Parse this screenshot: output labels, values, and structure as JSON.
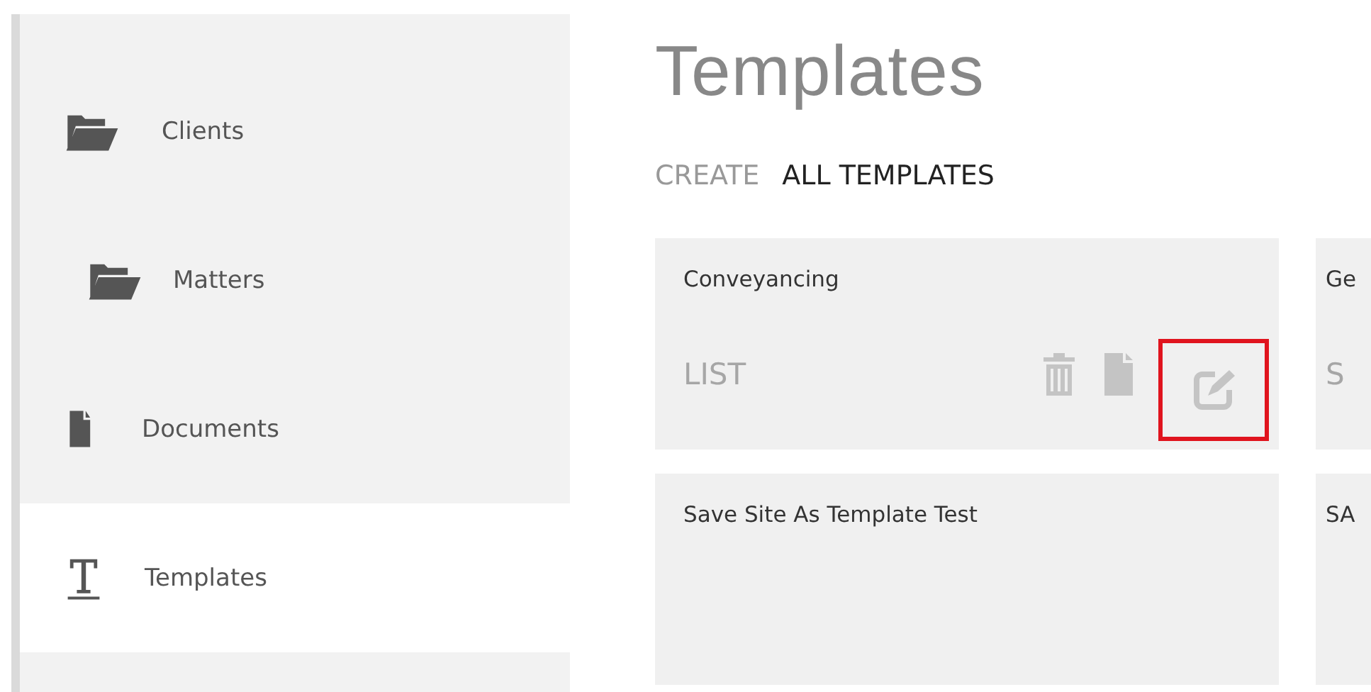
{
  "sidebar": {
    "items": [
      {
        "label": "Clients",
        "kind": "folder",
        "indented": false,
        "selected": false
      },
      {
        "label": "Matters",
        "kind": "folder",
        "indented": true,
        "selected": false
      },
      {
        "label": "Documents",
        "kind": "document",
        "indented": false,
        "selected": false
      },
      {
        "label": "Templates",
        "kind": "text",
        "indented": false,
        "selected": true
      }
    ]
  },
  "page": {
    "title": "Templates",
    "tabs": [
      {
        "label": "CREATE",
        "selected": false
      },
      {
        "label": "ALL TEMPLATES",
        "selected": true
      }
    ]
  },
  "cards": [
    {
      "title": "Conveyancing",
      "action": "LIST",
      "icons": [
        {
          "kind": "trash"
        },
        {
          "kind": "document"
        },
        {
          "kind": "edit",
          "highlighted": true
        }
      ]
    },
    {
      "title": "Ge",
      "action": "S"
    },
    {
      "title": "Save Site As Template Test"
    },
    {
      "title": "SA"
    }
  ]
}
